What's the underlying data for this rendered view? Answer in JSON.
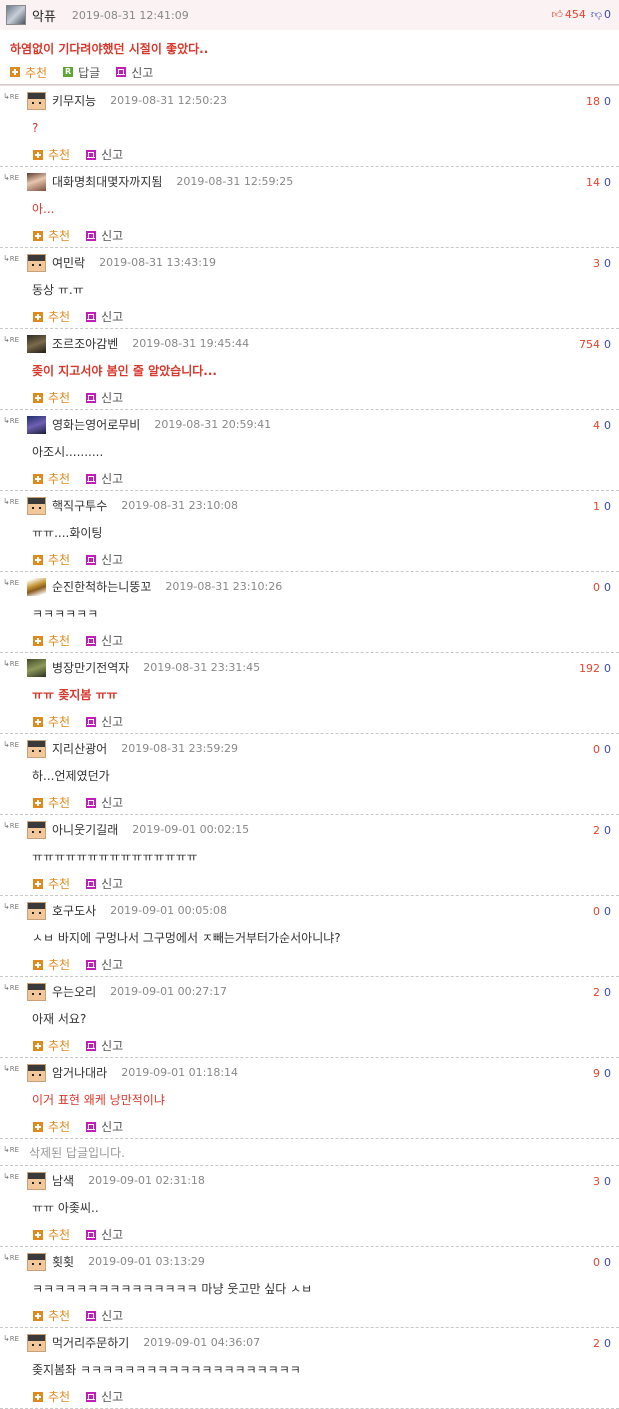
{
  "main_post": {
    "nickname": "악퓨",
    "datetime": "2019-08-31 12:41:09",
    "upvotes": "454",
    "downvotes": "0",
    "body": "하염없이 기다려야했던 시절이 좋았다..",
    "actions": {
      "recommend": "추천",
      "reply": "답글",
      "reply_badge": "R",
      "report": "신고"
    }
  },
  "reply_mark": "RE",
  "reply_action_labels": {
    "recommend": "추천",
    "report": "신고"
  },
  "replies": [
    {
      "nickname": "키무지능",
      "datetime": "2019-08-31 12:50:23",
      "up": "18",
      "down": "0",
      "body": "?",
      "avatar": "default"
    },
    {
      "nickname": "대화명최대몇자까지됨",
      "datetime": "2019-08-31 12:59:25",
      "up": "14",
      "down": "0",
      "body": "아...",
      "avatar": "girl"
    },
    {
      "nickname": "여민락",
      "datetime": "2019-08-31 13:43:19",
      "up": "3",
      "down": "0",
      "body": "동상 ㅠ.ㅠ",
      "avatar": "default"
    },
    {
      "nickname": "조르조아감벤",
      "datetime": "2019-08-31 19:45:44",
      "up": "754",
      "down": "0",
      "body": "좆이 지고서야 봄인 줄 알았습니다...",
      "avatar": "dark"
    },
    {
      "nickname": "영화는영어로무비",
      "datetime": "2019-08-31 20:59:41",
      "up": "4",
      "down": "0",
      "body": "아조시..........",
      "avatar": "night"
    },
    {
      "nickname": "핵직구투수",
      "datetime": "2019-08-31 23:10:08",
      "up": "1",
      "down": "0",
      "body": "ㅠㅠ....화이팅",
      "avatar": "default"
    },
    {
      "nickname": "순진한척하는니뚱꼬",
      "datetime": "2019-08-31 23:10:26",
      "up": "0",
      "down": "0",
      "body": "ㅋㅋㅋㅋㅋㅋ",
      "avatar": "pixel"
    },
    {
      "nickname": "병장만기전역자",
      "datetime": "2019-08-31 23:31:45",
      "up": "192",
      "down": "0",
      "body": "ㅠㅠ 좆지봄 ㅠㅠ",
      "avatar": "green"
    },
    {
      "nickname": "지리산광어",
      "datetime": "2019-08-31 23:59:29",
      "up": "0",
      "down": "0",
      "body": "하...언제였던가",
      "avatar": "default"
    },
    {
      "nickname": "아니웃기길래",
      "datetime": "2019-09-01 00:02:15",
      "up": "2",
      "down": "0",
      "body": "ㅠㅠㅠㅠㅠㅠㅠㅠㅠㅠㅠㅠㅠㅠㅠ",
      "avatar": "default"
    },
    {
      "nickname": "호구도사",
      "datetime": "2019-09-01 00:05:08",
      "up": "0",
      "down": "0",
      "body": "ㅅㅂ 바지에 구멍나서 그구멍에서 ㅈ빼는거부터가순서아니냐?",
      "avatar": "default"
    },
    {
      "nickname": "우는오리",
      "datetime": "2019-09-01 00:27:17",
      "up": "2",
      "down": "0",
      "body": "아재 서요?",
      "avatar": "default"
    },
    {
      "nickname": "암거나대라",
      "datetime": "2019-09-01 01:18:14",
      "up": "9",
      "down": "0",
      "body": "이거 표현 왜케 낭만적이냐",
      "avatar": "default"
    }
  ],
  "deleted_text": "삭제된 답글입니다.",
  "replies_after": [
    {
      "nickname": "남색",
      "datetime": "2019-09-01 02:31:18",
      "up": "3",
      "down": "0",
      "body": "ㅠㅠ 아좆씨..",
      "avatar": "default"
    },
    {
      "nickname": "횟횟",
      "datetime": "2019-09-01 03:13:29",
      "up": "0",
      "down": "0",
      "body": "ㅋㅋㅋㅋㅋㅋㅋㅋㅋㅋㅋㅋㅋㅋㅋ 마냥 웃고만 싶다 ㅅㅂ",
      "avatar": "default"
    },
    {
      "nickname": "먹거리주문하기",
      "datetime": "2019-09-01 04:36:07",
      "up": "2",
      "down": "0",
      "body": "좆지봄좌 ㅋㅋㅋㅋㅋㅋㅋㅋㅋㅋㅋㅋㅋㅋㅋㅋㅋㅋㅋㅋ",
      "avatar": "default"
    }
  ],
  "colors": {
    "upvote": "#e8432e",
    "downvote": "#3b49b5",
    "highlight_text": "#d8382c",
    "main_bg": "#fbf3f3"
  }
}
